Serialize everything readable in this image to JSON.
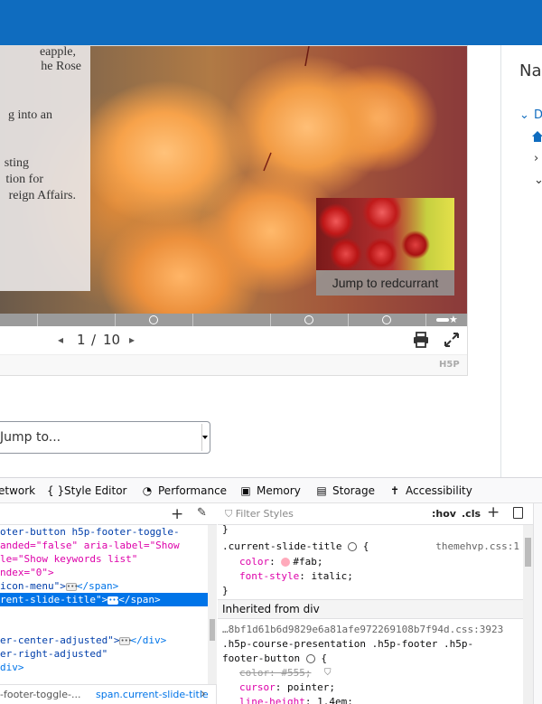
{
  "slide": {
    "text_lines": [
      "eapple,",
      "he Rose",
      "g into an",
      "sting",
      "tion for",
      "reign Affairs."
    ],
    "thumbnail_button": "Jump to redcurrant"
  },
  "navigation": {
    "current": "1",
    "separator": "/",
    "total": "10",
    "prev_icon": "◂",
    "next_icon": "▸"
  },
  "footer_brand": "H5P",
  "jump_select": "Jump to...",
  "drawer": {
    "title": "Nav",
    "row1": "D",
    "row3": "",
    "row4": ""
  },
  "devtools": {
    "tabs": [
      {
        "label": "etwork",
        "icon": ""
      },
      {
        "label": "Style Editor",
        "icon": "{ }"
      },
      {
        "label": "Performance",
        "icon": "◔"
      },
      {
        "label": "Memory",
        "icon": "▣"
      },
      {
        "label": "Storage",
        "icon": "▤"
      },
      {
        "label": "Accessibility",
        "icon": "✝"
      }
    ],
    "markup_lines": [
      "oter-button h5p-footer-toggle-",
      "anded=\"false\" aria-label=\"Show",
      "le=\"Show keywords list\"",
      "ndex=\"0\">",
      "icon-menu\">",
      "rent-slide-title\">",
      "er-center-adjusted\">",
      "er-right-adjusted\"",
      "div>"
    ],
    "breadcrumb_left": "-footer-toggle-...",
    "breadcrumb_right": "span.current-slide-title",
    "filter_placeholder": "Filter Styles",
    "hov": ":hov",
    "cls": ".cls",
    "rule1_selector": ".current-slide-title",
    "rule1_source": "themehvp.css:1",
    "rule1_color_prop": "color",
    "rule1_color_val": "#fab",
    "rule1_style_prop": "font-style",
    "rule1_style_val": "italic",
    "inherited_label": "Inherited from div",
    "rule2_source": "…8bf1d61b6d9829e6a81afe972269108b7f94d.css:3923",
    "rule2_selector_a": ".h5p-course-presentation .h5p-footer .h5p-",
    "rule2_selector_b": "footer-button",
    "rule2_color_prop": "color",
    "rule2_color_val": "#555",
    "rule2_cursor_prop": "cursor",
    "rule2_cursor_val": "pointer",
    "rule2_lh_prop": "line-height",
    "rule2_lh_val": "1.4em",
    "colors": {
      "accent": "#0f6cbf",
      "selection": "#0074e8",
      "swatch": "#ffaabb"
    }
  }
}
